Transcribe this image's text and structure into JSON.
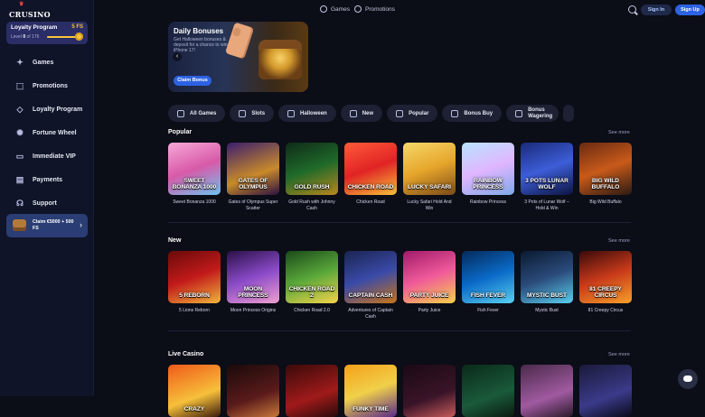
{
  "brand": {
    "logo_text": "CRUSINO"
  },
  "loyalty": {
    "title": "Loyalty Program",
    "free_spins": "5 FS",
    "level_label": "Level",
    "level_current": "0",
    "level_of": "of 176",
    "progress": 0.85
  },
  "sidebar": {
    "items": [
      {
        "label": "Games",
        "icon": "gamepad-icon"
      },
      {
        "label": "Promotions",
        "icon": "gift-icon"
      },
      {
        "label": "Loyalty Program",
        "icon": "diamond-icon"
      },
      {
        "label": "Fortune Wheel",
        "icon": "wheel-icon"
      },
      {
        "label": "Immediate VIP",
        "icon": "vip-icon"
      },
      {
        "label": "Payments",
        "icon": "wallet-icon"
      },
      {
        "label": "Support",
        "icon": "headset-icon"
      }
    ],
    "claim_text": "Claim €5000 + 500 FS"
  },
  "topbar": {
    "games": "Games",
    "promotions": "Promotions",
    "sign_in": "Sign In",
    "sign_up": "Sign Up"
  },
  "banner": {
    "title": "Daily Bonuses",
    "description": "Get Halloween bonuses & deposit for a chance to win iPhone 17!",
    "button": "Claim Bonus"
  },
  "categories": [
    {
      "label": "All Games"
    },
    {
      "label": "Slots"
    },
    {
      "label": "Halloween"
    },
    {
      "label": "New"
    },
    {
      "label": "Popular"
    },
    {
      "label": "Bonus Buy"
    },
    {
      "label": "Bonus Wagering"
    }
  ],
  "see_more": "See more",
  "sections": {
    "popular": {
      "title": "Popular",
      "games": [
        {
          "name": "Sweet Bonanza 1000",
          "art": "SWEET BONANZA 1000"
        },
        {
          "name": "Gates of Olympus Super Scatter",
          "art": "GATES OF OLYMPUS"
        },
        {
          "name": "Gold Rush with Johnny Cash",
          "art": "GOLD RUSH"
        },
        {
          "name": "Chicken Road",
          "art": "CHICKEN ROAD"
        },
        {
          "name": "Lucky Safari Hold And Win",
          "art": "LUCKY SAFARI"
        },
        {
          "name": "Rainbow Princess",
          "art": "RAINBOW PRINCESS"
        },
        {
          "name": "3 Pots of Lunar Wolf – Hold & Win",
          "art": "3 POTS LUNAR WOLF"
        },
        {
          "name": "Big Wild Buffalo",
          "art": "BIG WILD BUFFALO"
        }
      ]
    },
    "new": {
      "title": "New",
      "games": [
        {
          "name": "5 Lions Reborn",
          "art": "5 REBORN"
        },
        {
          "name": "Moon Princess Origins",
          "art": "MOON PRINCESS"
        },
        {
          "name": "Chicken Road 2.0",
          "art": "CHICKEN ROAD 2"
        },
        {
          "name": "Adventures of Captain Cash",
          "art": "CAPTAIN CASH"
        },
        {
          "name": "Party Juice",
          "art": "PARTY JUICE"
        },
        {
          "name": "Fish Fever",
          "art": "FISH FEVER"
        },
        {
          "name": "Mystic Bust",
          "art": "MYSTIC BUST"
        },
        {
          "name": "81 Creepy Circus",
          "art": "81 CREEPY CIRCUS"
        }
      ]
    },
    "live": {
      "title": "Live Casino",
      "games": [
        {
          "art": "CRAZY"
        },
        {
          "art": ""
        },
        {
          "art": ""
        },
        {
          "art": "FUNKY TIME"
        },
        {
          "art": ""
        },
        {
          "art": ""
        },
        {
          "art": ""
        },
        {
          "art": ""
        }
      ]
    }
  },
  "colors": {
    "accent": "#2d62e3",
    "background": "#0b0d17",
    "sidebar": "#101428",
    "gold": "#f5c63c"
  }
}
